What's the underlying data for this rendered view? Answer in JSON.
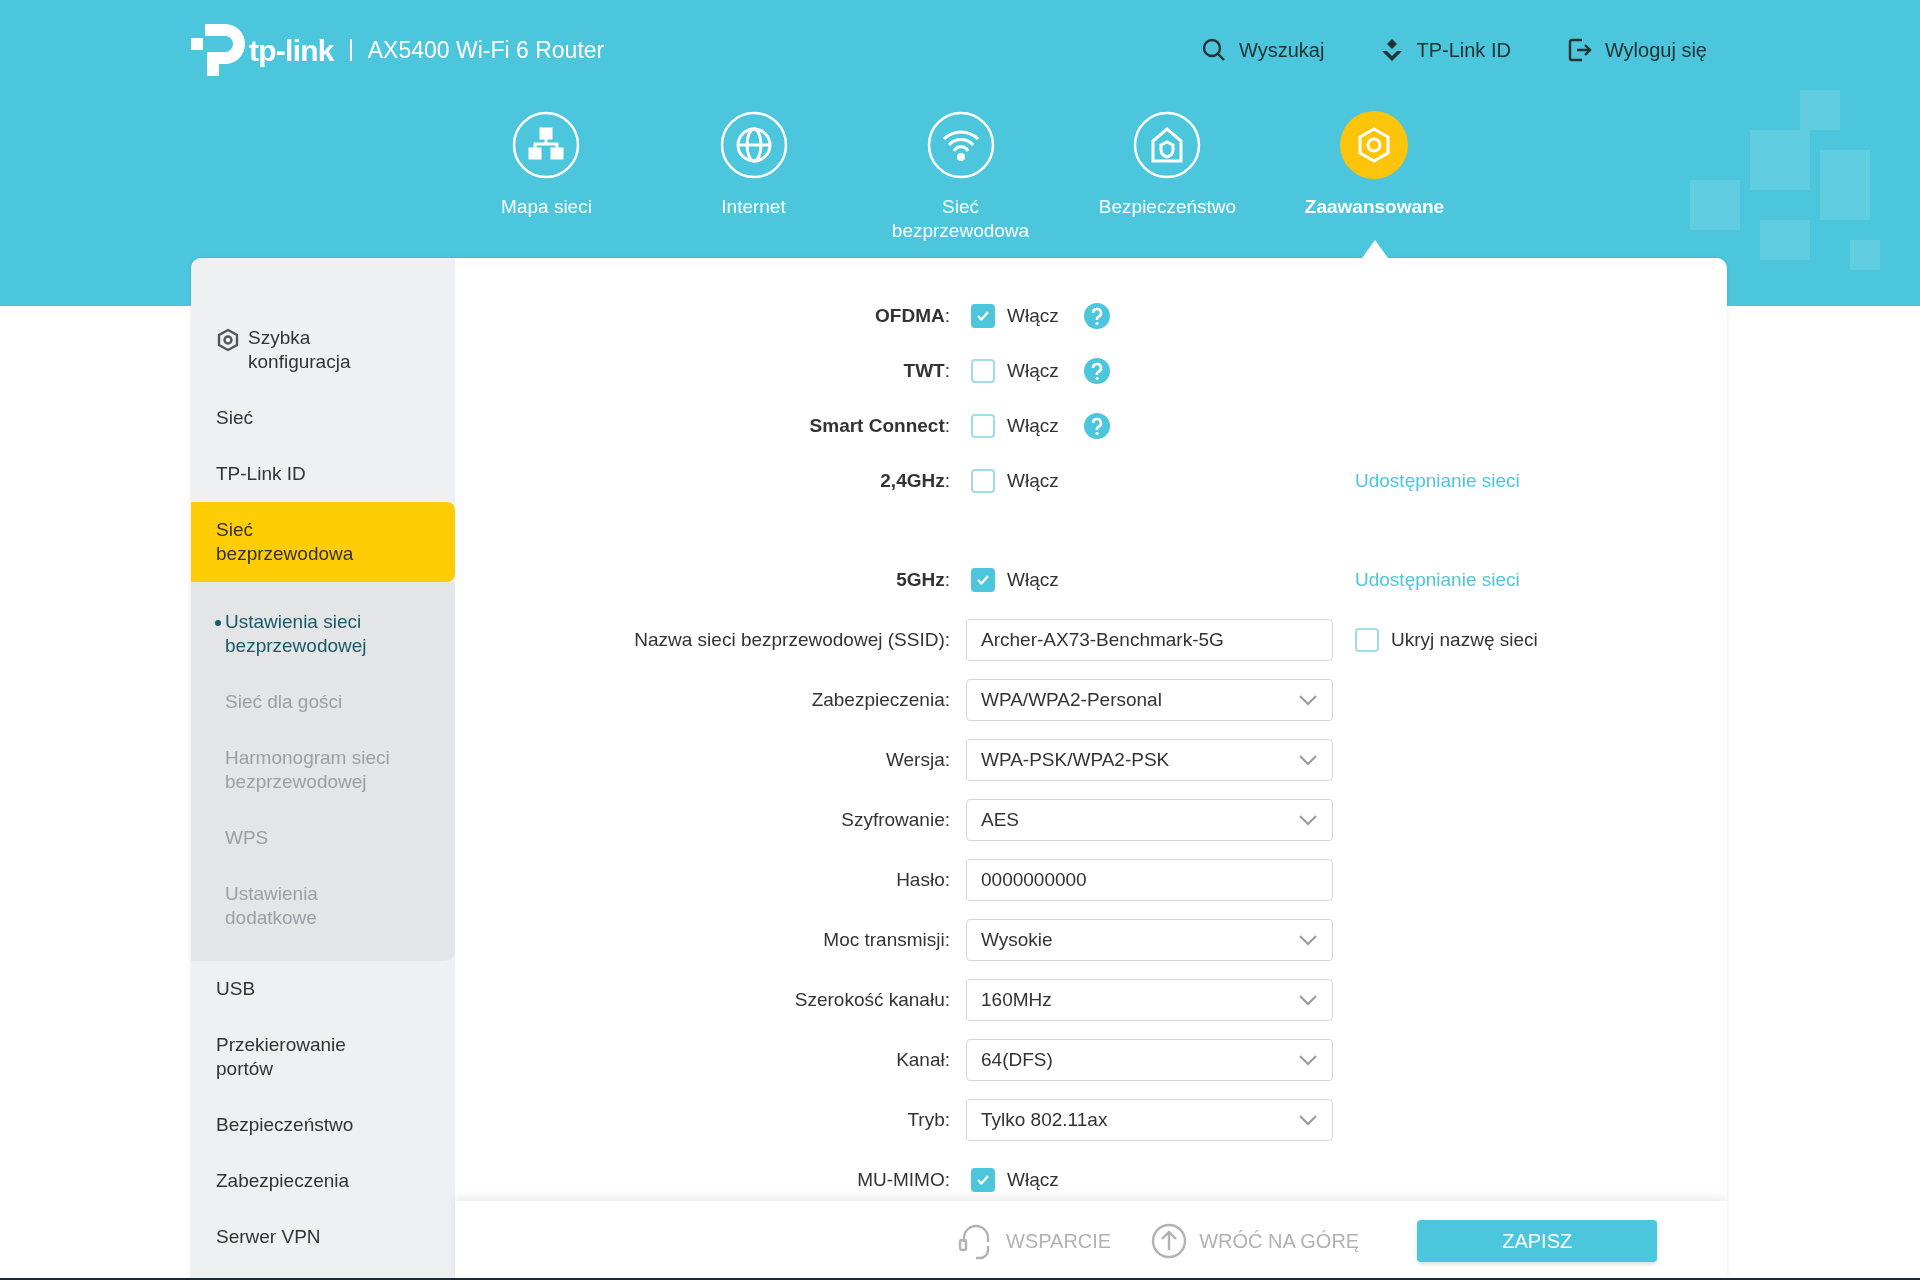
{
  "header": {
    "brand": "tp-link",
    "model": "AX5400 Wi-Fi 6 Router",
    "links": [
      {
        "kind": "search",
        "label": "Wyszukaj"
      },
      {
        "kind": "account",
        "label": "TP-Link ID"
      },
      {
        "kind": "logout",
        "label": "Wyloguj się"
      }
    ]
  },
  "nav": [
    {
      "kind": "map",
      "label": "Mapa sieci",
      "selected": false
    },
    {
      "kind": "globe",
      "label": "Internet",
      "selected": false
    },
    {
      "kind": "wifi",
      "label": "Sieć bezprzewodowa",
      "selected": false
    },
    {
      "kind": "shield",
      "label": "Bezpieczeństwo",
      "selected": false
    },
    {
      "kind": "gear",
      "label": "Zaawansowane",
      "selected": true
    }
  ],
  "sidebar": {
    "items": [
      {
        "kind": "setup",
        "label": "Szybka konfiguracja",
        "selected": false
      },
      {
        "kind": "page",
        "label": "Sieć",
        "selected": false
      },
      {
        "kind": "page",
        "label": "TP-Link ID",
        "selected": false
      },
      {
        "kind": "page",
        "label": "Sieć bezprzewodowa",
        "selected": true,
        "children": [
          {
            "label": "Ustawienia sieci bezprzewodowej",
            "selected": true
          },
          {
            "label": "Sieć dla gości",
            "selected": false
          },
          {
            "label": "Harmonogram sieci bezprzewodowej",
            "selected": false
          },
          {
            "label": "WPS",
            "selected": false
          },
          {
            "label": "Ustawienia dodatkowe",
            "selected": false
          }
        ]
      },
      {
        "kind": "page",
        "label": "USB",
        "selected": false
      },
      {
        "kind": "page",
        "label": "Przekierowanie portów",
        "selected": false
      },
      {
        "kind": "page",
        "label": "Bezpieczeństwo",
        "selected": false
      },
      {
        "kind": "page",
        "label": "Zabezpieczenia",
        "selected": false
      },
      {
        "kind": "page",
        "label": "Serwer VPN",
        "selected": false
      }
    ]
  },
  "form_groups": [
    [
      {
        "kind": "checkbox",
        "label": "**OFDMA**:",
        "option": "Włącz",
        "checked": true,
        "help": true
      },
      {
        "kind": "checkbox",
        "label": "**TWT**:",
        "option": "Włącz",
        "checked": false,
        "help": true
      },
      {
        "kind": "checkbox",
        "label": "**Smart Connect**:",
        "option": "Włącz",
        "checked": false,
        "help": true
      },
      {
        "kind": "checkbox",
        "label": "**2,4GHz**:",
        "option": "Włącz",
        "checked": false,
        "link": "Udostępnianie sieci"
      }
    ],
    [
      {
        "kind": "checkbox",
        "label": "**5GHz**:",
        "option": "Włącz",
        "checked": true,
        "link": "Udostępnianie sieci"
      },
      {
        "kind": "text",
        "label": "Nazwa sieci bezprzewodowej (SSID):",
        "value": "Archer-AX73-Benchmark-5G",
        "extra": {
          "label": "Ukryj nazwę sieci",
          "checked": false
        }
      },
      {
        "kind": "select",
        "label": "Zabezpieczenia:",
        "value": "WPA/WPA2-Personal"
      },
      {
        "kind": "select",
        "label": "Wersja:",
        "value": "WPA-PSK/WPA2-PSK"
      },
      {
        "kind": "select",
        "label": "Szyfrowanie:",
        "value": "AES"
      },
      {
        "kind": "text",
        "label": "Hasło:",
        "value": "0000000000"
      },
      {
        "kind": "select",
        "label": "Moc transmisji:",
        "value": "Wysokie"
      },
      {
        "kind": "select",
        "label": "Szerokość kanału:",
        "value": "160MHz"
      },
      {
        "kind": "select",
        "label": "Kanał:",
        "value": "64(DFS)"
      },
      {
        "kind": "select",
        "label": "Tryb:",
        "value": "Tylko 802.11ax"
      },
      {
        "kind": "checkbox",
        "label": "MU-MIMO:",
        "option": "Włącz",
        "checked": true
      }
    ]
  ],
  "footer": {
    "support": "WSPARCIE",
    "back_to_top": "WRÓĆ NA GÓRĘ",
    "save": "ZAPISZ"
  }
}
